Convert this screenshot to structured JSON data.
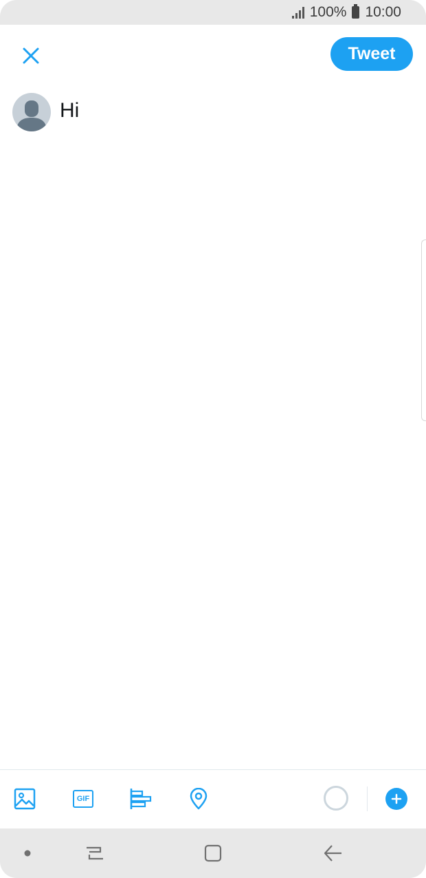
{
  "status_bar": {
    "battery_percent": "100%",
    "time": "10:00",
    "icons": [
      "signal-icon",
      "battery-icon"
    ]
  },
  "header": {
    "close_icon": "close-icon",
    "tweet_label": "Tweet"
  },
  "compose": {
    "avatar_icon": "default-avatar-icon",
    "text": "Hi"
  },
  "toolbar": {
    "icons": [
      "image-icon",
      "gif-icon",
      "poll-icon",
      "location-icon",
      "character-counter",
      "add-tweet-icon"
    ],
    "gif_label": "GIF"
  },
  "navigation_bar": {
    "icons": [
      "nav-dot-icon",
      "recent-apps-icon",
      "home-icon",
      "back-icon"
    ]
  },
  "colors": {
    "accent": "#1da1f2",
    "status_bar_bg": "#e8e8e8",
    "counter_ring": "#ccd6dd"
  }
}
